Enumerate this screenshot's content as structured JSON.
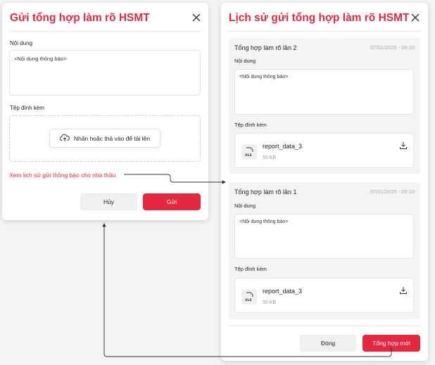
{
  "send_modal": {
    "title": "Gửi tổng hợp làm rõ HSMT",
    "content_label": "Nội dung",
    "content_value": "<Nội dung thông báo>",
    "attachment_label": "Tệp đính kèm",
    "upload_label": "Nhấn hoặc thả vào để tải lên",
    "history_link": "Xem lịch sử gửi thông báo cho nhà thầu",
    "cancel_label": "Hủy",
    "send_label": "Gửi"
  },
  "history_modal": {
    "title": "Lịch sử gửi tổng hợp làm rõ HSMT",
    "entries": [
      {
        "title": "Tổng hợp làm rõ lần 2",
        "date": "07/01/2025 - 09:10",
        "content_label": "Nội dung",
        "content_value": "<Nội dung thông báo>",
        "attachment_label": "Tệp đính kèm",
        "file_name": "report_data_3",
        "file_size": "50 KB",
        "file_type": "XLS"
      },
      {
        "title": "Tổng hợp làm rõ lần 1",
        "date": "07/01/2025 - 09:10",
        "content_label": "Nội dung",
        "content_value": "<Nội dung thông báo>",
        "attachment_label": "Tệp đính kèm",
        "file_name": "report_data_3",
        "file_size": "50 KB",
        "file_type": "XLS"
      }
    ],
    "close_label": "Đóng",
    "new_label": "Tổng hợp mới"
  },
  "colors": {
    "accent": "#e4283d"
  }
}
